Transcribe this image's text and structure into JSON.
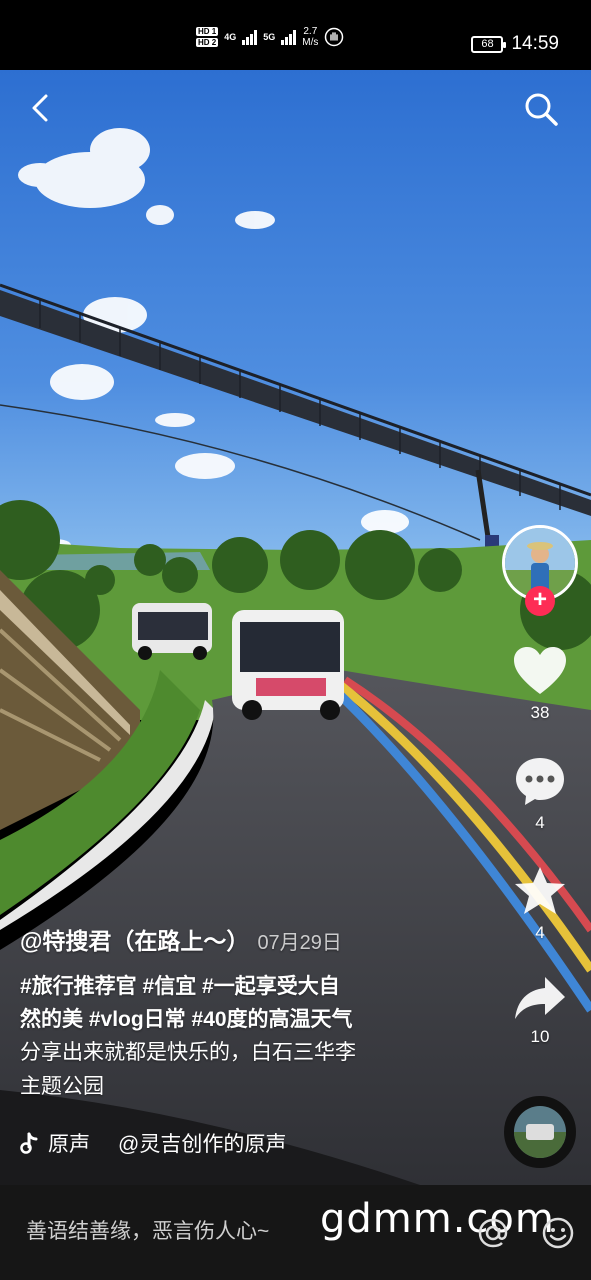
{
  "status_bar": {
    "hd1": "HD 1",
    "hd2": "HD 2",
    "net1": "4G",
    "net2": "5G",
    "speed_value": "2.7",
    "speed_unit": "M/s",
    "battery": "68",
    "time": "14:59"
  },
  "video": {
    "back_icon": "chevron-left-icon",
    "search_icon": "search-icon"
  },
  "actions": {
    "follow_label": "+",
    "likes": "38",
    "comments": "4",
    "favorites": "4",
    "shares": "10"
  },
  "caption": {
    "author": "@特搜君（在路上～）",
    "date": "07月29日",
    "hashtags_line1": "#旅行推荐官 #信宜 #一起享受大自",
    "hashtags_line2": "然的美 #vlog日常 #40度的高温天气",
    "desc_line1": "分享出来就都是快乐的，白石三华李",
    "desc_line2": "主题公园"
  },
  "music": {
    "label": "原声",
    "source": "@灵吉创作的原声"
  },
  "bottom_bar": {
    "comment_placeholder": "善语结善缘，恶言伤人心~",
    "watermark": "gdmm.com",
    "mention_icon": "at-icon",
    "emoji_icon": "emoji-icon"
  },
  "colors": {
    "follow": "#fe2c55",
    "sky_top": "#2d6fd1",
    "sky_bottom": "#6ea7e6",
    "grass": "#4e8a2e",
    "road": "#3c3d42"
  }
}
